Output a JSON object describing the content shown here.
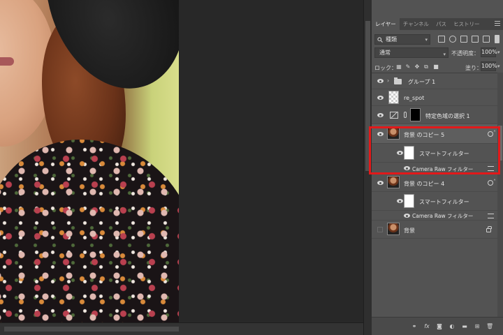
{
  "tabs": [
    {
      "label": "レイヤー",
      "active": true
    },
    {
      "label": "チャンネル",
      "active": false
    },
    {
      "label": "パス",
      "active": false
    },
    {
      "label": "ヒストリー",
      "active": false
    }
  ],
  "filter": {
    "kind_label": "種類"
  },
  "blend": {
    "mode": "通常",
    "opacity_label": "不透明度：",
    "opacity_value": "100%"
  },
  "lock": {
    "label": "ロック：",
    "fill_label": "塗り：",
    "fill_value": "100%"
  },
  "layers": [
    {
      "name": "グループ 1",
      "type": "group",
      "visible": true
    },
    {
      "name": "re_spot",
      "type": "pixel",
      "visible": true
    },
    {
      "name": "特定色域の選択 1",
      "type": "adjustment",
      "visible": true
    },
    {
      "name": "背景 のコピー 5",
      "type": "smart-object",
      "visible": true,
      "highlighted": true
    },
    {
      "name": "スマートフィルター",
      "type": "smart-filter-header",
      "visible": true
    },
    {
      "name": "Camera Raw フィルター",
      "type": "filter",
      "visible": true
    },
    {
      "name": "背景 のコピー 4",
      "type": "smart-object",
      "visible": true
    },
    {
      "name": "スマートフィルター",
      "type": "smart-filter-header",
      "visible": true
    },
    {
      "name": "Camera Raw フィルター",
      "type": "filter",
      "visible": true
    },
    {
      "name": "背景",
      "type": "background",
      "visible": false,
      "locked": true
    }
  ],
  "colors": {
    "highlight": "#e2191a",
    "panel_bg": "#535353",
    "canvas_bg": "#282828"
  }
}
